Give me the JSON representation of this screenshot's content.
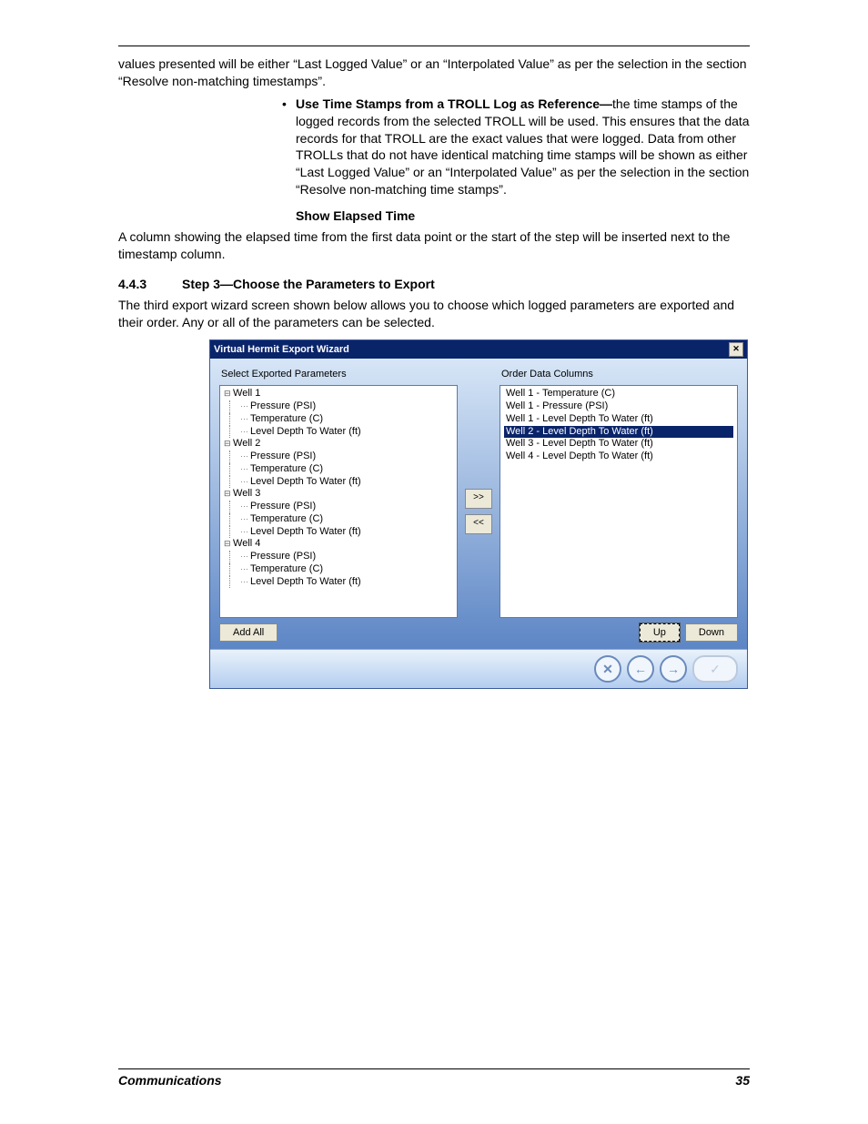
{
  "doc": {
    "para_cont": "values presented will be either “Last Logged Value” or an “Interpolated Value” as per the selection in the section “Resolve non-matching timestamps”.",
    "bullet_bold": "Use Time Stamps from a TROLL Log as Reference—",
    "bullet_text": "the time stamps of the logged records from the selected TROLL will be used. This ensures that the data records for that TROLL are the exact values that were logged. Data from other TROLLs that do not have identical matching time stamps will be shown as either “Last Logged Value” or an “Interpolated Value” as per the selection in the section “Resolve non-matching time stamps”.",
    "subhead1": "Show Elapsed Time",
    "para2": "A column showing the elapsed time from the first data point or the start of the step will be inserted next to the timestamp column.",
    "sec_num": "4.4.3",
    "sec_title": "Step 3—Choose the Parameters to Export",
    "para3": "The third export wizard screen shown below allows you to choose which logged parameters are exported and their order. Any or all of the parameters can be selected."
  },
  "wizard": {
    "title": "Virtual Hermit Export Wizard",
    "left_label": "Select Exported Parameters",
    "right_label": "Order Data Columns",
    "wells": [
      {
        "name": "Well 1",
        "params": [
          "Pressure (PSI)",
          "Temperature (C)",
          "Level Depth To Water (ft)"
        ]
      },
      {
        "name": "Well 2",
        "params": [
          "Pressure (PSI)",
          "Temperature (C)",
          "Level Depth To Water (ft)"
        ]
      },
      {
        "name": "Well 3",
        "params": [
          "Pressure (PSI)",
          "Temperature (C)",
          "Level Depth To Water (ft)"
        ]
      },
      {
        "name": "Well 4",
        "params": [
          "Pressure (PSI)",
          "Temperature (C)",
          "Level Depth To Water (ft)"
        ]
      }
    ],
    "order": [
      {
        "label": "Well 1 - Temperature (C)",
        "selected": false
      },
      {
        "label": "Well 1 - Pressure (PSI)",
        "selected": false
      },
      {
        "label": "Well 1 - Level Depth To Water (ft)",
        "selected": false
      },
      {
        "label": "Well 2 - Level Depth To Water (ft)",
        "selected": true
      },
      {
        "label": "Well 3 - Level Depth To Water (ft)",
        "selected": false
      },
      {
        "label": "Well 4 - Level Depth To Water (ft)",
        "selected": false
      }
    ],
    "btn_add": ">>",
    "btn_remove": "<<",
    "btn_add_all": "Add All",
    "btn_up": "Up",
    "btn_down": "Down",
    "nav_cancel": "✕",
    "nav_back": "←",
    "nav_next": "→",
    "nav_finish": "✓"
  },
  "footer": {
    "left": "Communications",
    "right": "35"
  }
}
